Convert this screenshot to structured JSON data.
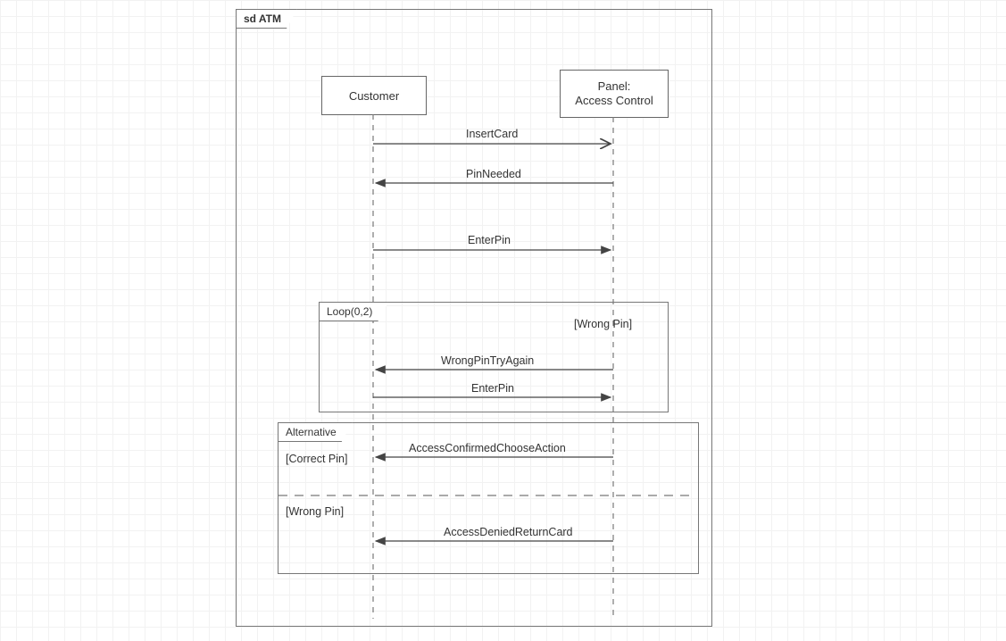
{
  "diagram": {
    "title": "sd ATM",
    "actors": {
      "customer": "Customer",
      "panel_line1": "Panel:",
      "panel_line2": "Access Control"
    },
    "messages": {
      "insertCard": "InsertCard",
      "pinNeeded": "PinNeeded",
      "enterPin": "EnterPin",
      "wrongPinTryAgain": "WrongPinTryAgain",
      "enterPin2": "EnterPin",
      "accessConfirmed": "AccessConfirmedChooseAction",
      "accessDenied": "AccessDeniedReturnCard"
    },
    "fragments": {
      "loopLabel": "Loop(0,2)",
      "loopGuard": "[Wrong Pin]",
      "altLabel": "Alternative",
      "altGuard1": "[Correct Pin]",
      "altGuard2": "[Wrong Pin]"
    }
  }
}
